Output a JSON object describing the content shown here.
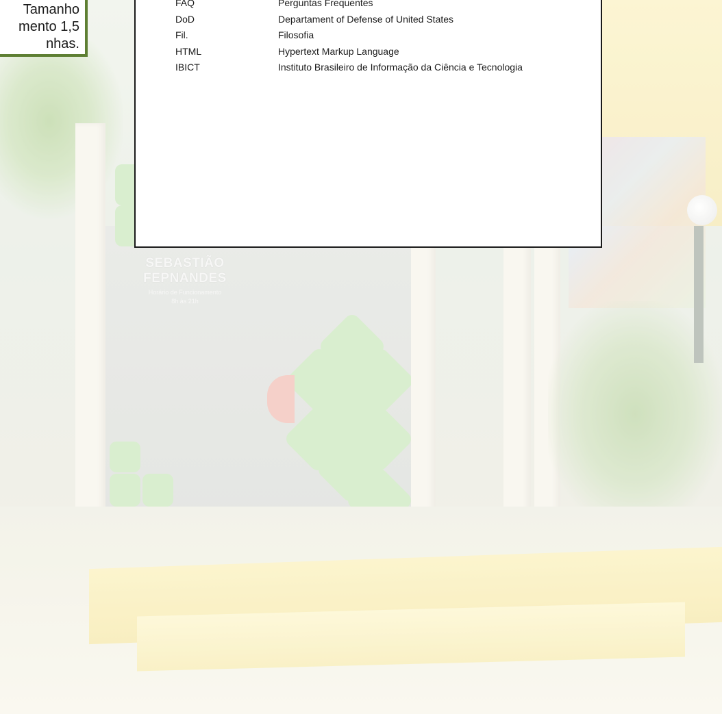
{
  "callout": {
    "lines": [
      "Tamanho",
      "mento 1,5",
      "nhas."
    ]
  },
  "abbreviations": [
    {
      "term": "FAQ",
      "definition": "Perguntas Frequentes"
    },
    {
      "term": "DoD",
      "definition": "Departament of Defense of United States"
    },
    {
      "term": "Fil.",
      "definition": "Filosofia"
    },
    {
      "term": "HTML",
      "definition": "Hypertext Markup Language"
    },
    {
      "term": "IBICT",
      "definition": "Instituto Brasileiro de Informação da Ciência e Tecnologia"
    }
  ],
  "sign": {
    "name": "SEBASTIÃO FEPNANDES",
    "hours_line1": "Horário de Funcionamento",
    "hours_line2": "8h às 21h"
  }
}
